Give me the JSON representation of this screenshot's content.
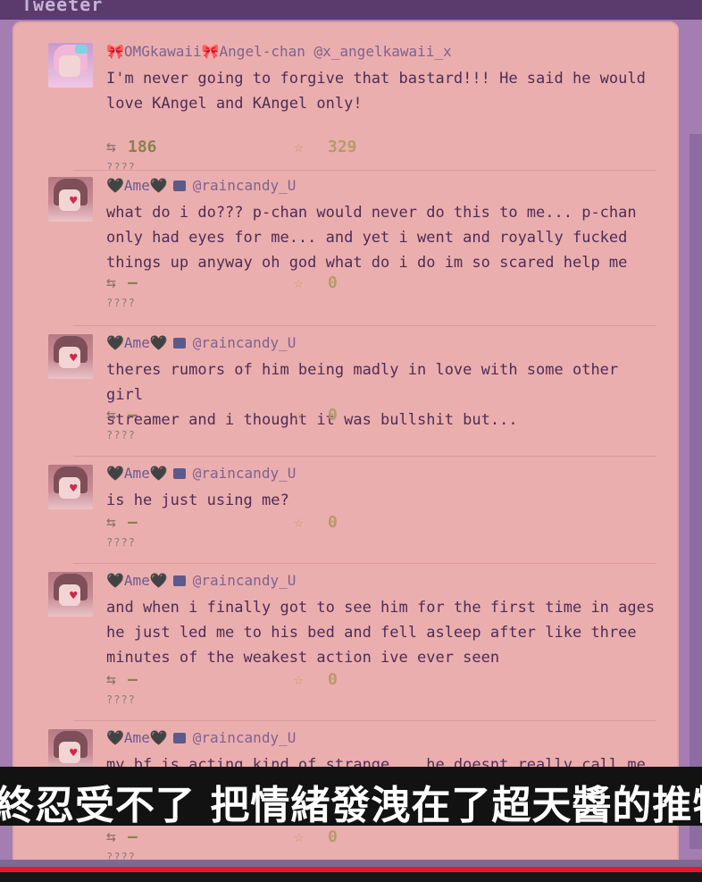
{
  "app": {
    "title": "Tweeter"
  },
  "tweets": [
    {
      "display_name": "🎀OMGkawaii🎀Angel-chan",
      "handle": "@x_angelkawaii_x",
      "text": "I'm never going to forgive that bastard!!! He said he would\nlove KAngel and KAngel only!",
      "retweets": "186",
      "likes": "329",
      "time": "????",
      "avatar": "kangel-avatar"
    },
    {
      "display_name": "🖤Ame🖤",
      "handle": "@raincandy_U",
      "text": "what do i do??? p-chan would never do this to me... p-chan\nonly had eyes for me... and yet i went and royally fucked\nthings up anyway oh god what do i do im so scared help me",
      "retweets": "–",
      "likes": "0",
      "time": "????",
      "avatar": "ame-avatar"
    },
    {
      "display_name": "🖤Ame🖤",
      "handle": "@raincandy_U",
      "text": "theres rumors of him being madly in love with some other girl\nstreamer and i thought it was bullshit but...",
      "retweets": "–",
      "likes": "0",
      "time": "????",
      "avatar": "ame-avatar"
    },
    {
      "display_name": "🖤Ame🖤",
      "handle": "@raincandy_U",
      "text": "is he just using me?",
      "retweets": "–",
      "likes": "0",
      "time": "????",
      "avatar": "ame-avatar"
    },
    {
      "display_name": "🖤Ame🖤",
      "handle": "@raincandy_U",
      "text": "and when i finally got to see him for the first time in ages\nhe just led me to his bed and fell asleep after like three\nminutes of the weakest action ive ever seen",
      "retweets": "–",
      "likes": "0",
      "time": "????",
      "avatar": "ame-avatar"
    },
    {
      "display_name": "🖤Ame🖤",
      "handle": "@raincandy_U",
      "text": "my bf is acting kind of strange... he doesnt really call me",
      "retweets": "–",
      "likes": "0",
      "time": "????",
      "avatar": "ame-avatar"
    }
  ],
  "subtitle": {
    "text": "終忍受不了 把情緒發洩在了超天醬的推特"
  },
  "video": {
    "progress": 1.0,
    "progress_color": "#e51b23"
  },
  "colors": {
    "panel": "#ebaeae",
    "text": "#4d2d55",
    "handle": "#7d6291"
  }
}
